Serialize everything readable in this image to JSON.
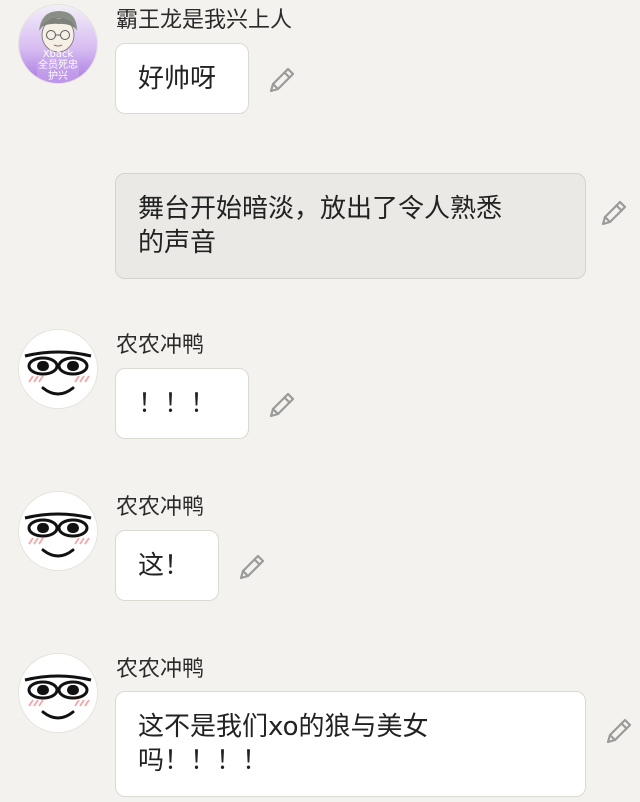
{
  "messages": [
    {
      "sender": "霸王龙是我兴上人",
      "text": "好帅呀",
      "avatar_label_1": "Xback",
      "avatar_label_2": "全员死忠",
      "avatar_label_3": "护兴"
    },
    {
      "sender": "",
      "text_line1": "舞台开始暗淡，放出了令人熟悉",
      "text_line2": "的声音"
    },
    {
      "sender": "农农冲鸭",
      "text": "！！！"
    },
    {
      "sender": "农农冲鸭",
      "text": "这！"
    },
    {
      "sender": "农农冲鸭",
      "text_line1": "这不是我们xo的狼与美女",
      "text_line2": "吗！！！！"
    }
  ],
  "icons": {
    "edit": "pencil-edit-icon",
    "avatar_default": "smiley-face-icon",
    "avatar_user1": "anime-boy-avatar-icon"
  },
  "colors": {
    "background": "#f4f2ee",
    "bubble": "#ffffff",
    "bubble_narration": "#ebe9e6",
    "blush": "#f4a6a6",
    "avatar_purple": "#b48ae0"
  }
}
